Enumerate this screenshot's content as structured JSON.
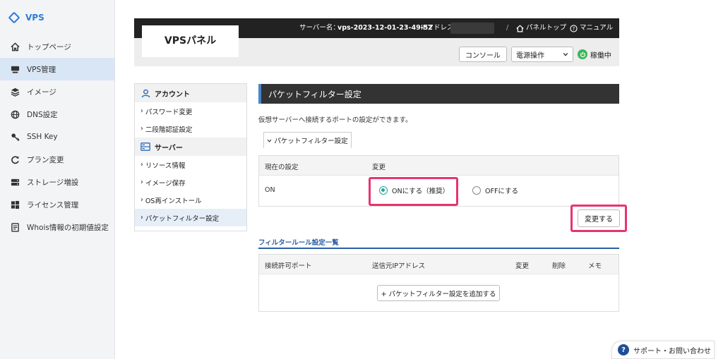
{
  "nav": {
    "brand": "VPS",
    "items": [
      {
        "label": "トップページ",
        "icon": "home-icon"
      },
      {
        "label": "VPS管理",
        "icon": "server-icon",
        "active": true
      },
      {
        "label": "イメージ",
        "icon": "layers-icon"
      },
      {
        "label": "DNS設定",
        "icon": "globe-icon"
      },
      {
        "label": "SSH Key",
        "icon": "key-icon"
      },
      {
        "label": "プラン変更",
        "icon": "refresh-icon"
      },
      {
        "label": "ストレージ増設",
        "icon": "storage-icon"
      },
      {
        "label": "ライセンス管理",
        "icon": "windows-icon"
      },
      {
        "label": "Whois情報の初期値設定",
        "icon": "document-icon"
      }
    ]
  },
  "header": {
    "panel_title": "VPSパネル",
    "server_name_label": "サーバー名：",
    "server_name": "vps-2023-12-01-23-49-52",
    "ip_label": "IPアドレス",
    "separator": "/",
    "panel_top": "パネルトップ",
    "manual": "マニュアル",
    "console": "コンソール",
    "power_select": "電源操作",
    "status": "稼働中"
  },
  "sidebar": {
    "account_heading": "アカウント",
    "account_links": [
      "パスワード変更",
      "二段階認証設定"
    ],
    "server_heading": "サーバー",
    "server_links": [
      "リソース情報",
      "イメージ保存",
      "OS再インストール",
      "パケットフィルター設定"
    ],
    "link_prefix": "›"
  },
  "main": {
    "title": "パケットフィルター設定",
    "description": "仮想サーバーへ接続するポートの設定ができます。",
    "tab_label": "パケットフィルター設定",
    "table": {
      "col_current": "現在の設定",
      "col_change": "変更",
      "current_value": "ON",
      "option_on": "ONにする（推奨）",
      "option_off": "OFFにする",
      "selected": "on"
    },
    "save_button": "変更する",
    "filter_rules": {
      "title": "フィルタールール設定一覧",
      "columns": [
        "接続許可ポート",
        "送信元IPアドレス",
        "変更",
        "削除",
        "メモ"
      ],
      "add_button": "+ パケットフィルター設定を追加する"
    }
  },
  "support": {
    "label": "サポート・お問い合わせ",
    "icon_text": "?"
  }
}
